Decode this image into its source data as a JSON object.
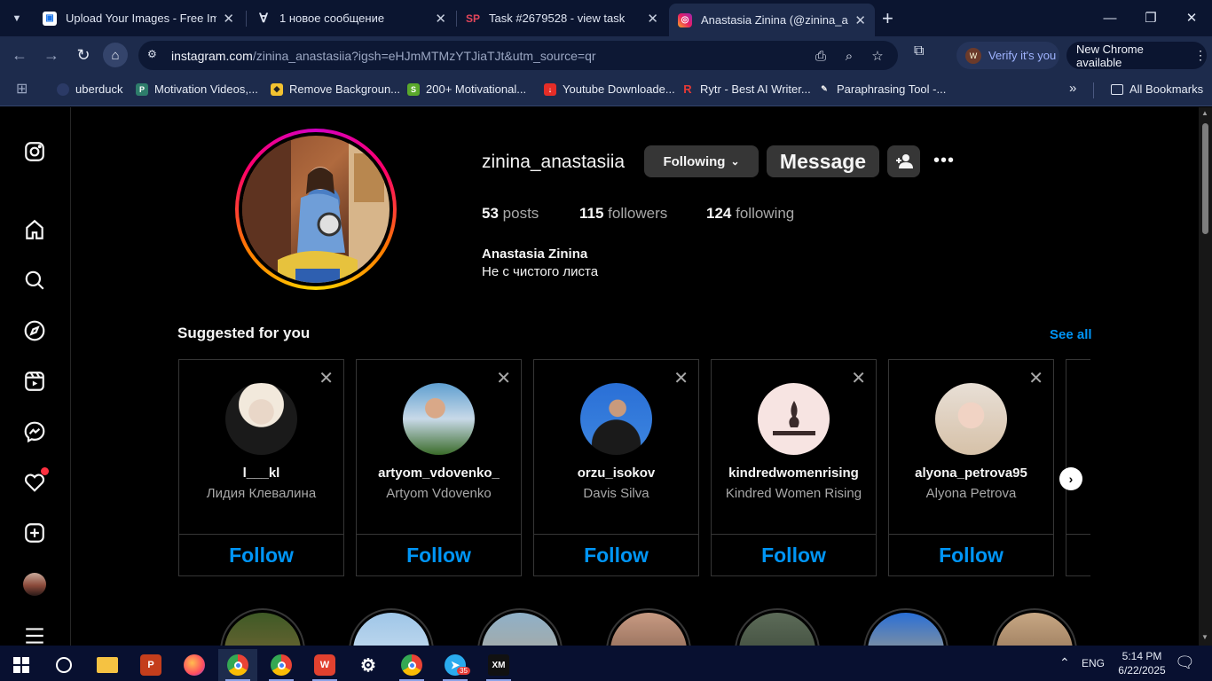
{
  "browser": {
    "tabs": [
      {
        "title": "Upload Your Images - Free Imag",
        "active": false
      },
      {
        "title": "1 новое сообщение",
        "active": false
      },
      {
        "title": "Task #2679528 - view task",
        "active": false
      },
      {
        "title": "Anastasia Zinina (@zinina_anast",
        "active": true
      }
    ],
    "url_domain": "instagram.com",
    "url_path": "/zinina_anastasiia?igsh=eHJmMTMzYTJiaTJt&utm_source=qr",
    "verify_label": "Verify it's you",
    "update_label": "New Chrome available",
    "bookmarks": [
      "uberduck",
      "Motivation Videos,...",
      "Remove Backgroun...",
      "200+ Motivational...",
      "Youtube Downloade...",
      "Rytr - Best AI Writer...",
      "Paraphrasing Tool -..."
    ],
    "all_bookmarks_label": "All Bookmarks"
  },
  "profile": {
    "username": "zinina_anastasiia",
    "following_button": "Following",
    "message_button": "Message",
    "more_glyph": "•••",
    "posts_count": "53",
    "posts_label": "posts",
    "followers_count": "115",
    "followers_label": "followers",
    "following_count": "124",
    "following_label": "following",
    "full_name": "Anastasia Zinina",
    "bio": "Не с чистого листа"
  },
  "suggestions": {
    "title": "Suggested for you",
    "see_all": "See all",
    "follow_label": "Follow",
    "close_glyph": "✕",
    "items": [
      {
        "username": "l___kl",
        "name": "Лидия Клевалина"
      },
      {
        "username": "artyom_vdovenko_",
        "name": "Artyom Vdovenko"
      },
      {
        "username": "orzu_isokov",
        "name": "Davis Silva"
      },
      {
        "username": "kindredwomenrising",
        "name": "Kindred Women Rising"
      },
      {
        "username": "alyona_petrova95",
        "name": "Alyona Petrova"
      }
    ]
  },
  "taskbar": {
    "language": "ENG",
    "time": "5:14 PM",
    "date": "6/22/2025",
    "telegram_badge": "35"
  },
  "colors": {
    "accent_blue": "#0095f6",
    "chrome_dark": "#0b1530",
    "chrome_toolbar": "#1d2b4c",
    "button_gray": "#363636",
    "notification_red": "#ff3040"
  }
}
